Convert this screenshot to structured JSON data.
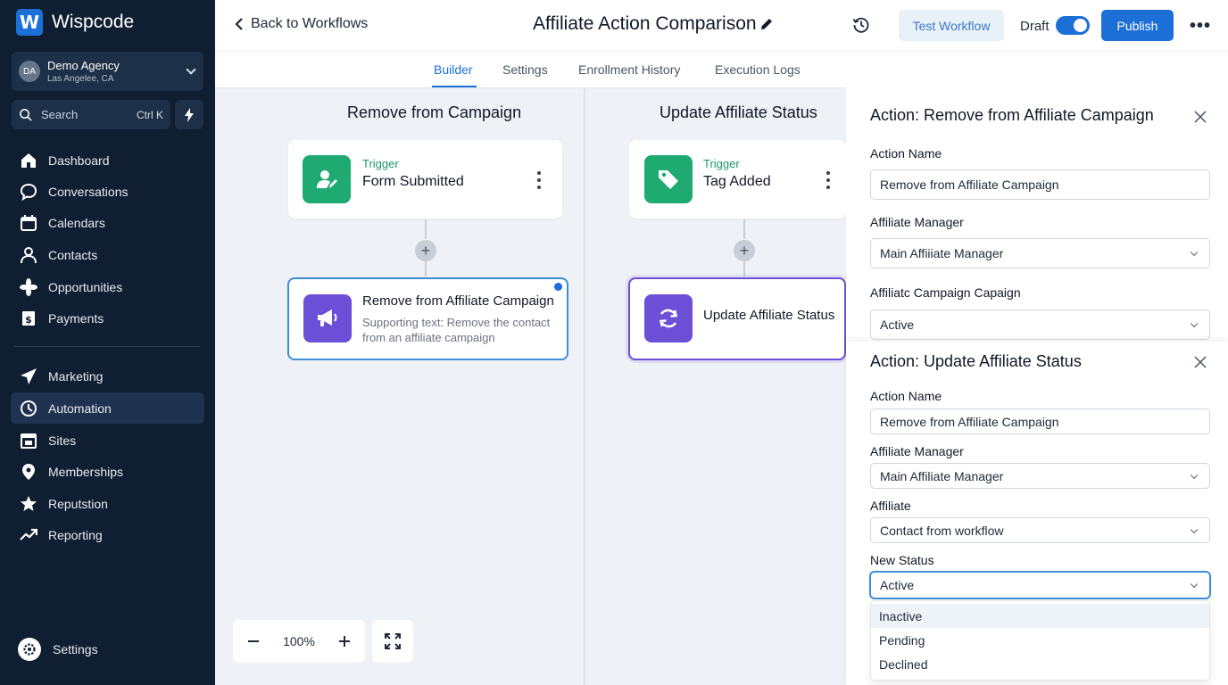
{
  "brand": {
    "logo_letter": "W",
    "name": "Wispcode"
  },
  "account": {
    "initials": "DA",
    "name": "Demo Agency",
    "location": "Las Angelee, CA"
  },
  "search": {
    "label": "Search",
    "shortcut": "Ctrl K"
  },
  "nav": {
    "dashboard": "Dashboard",
    "conversations": "Conversations",
    "calendars": "Calendars",
    "contacts": "Contacts",
    "opportunities": "Opportunities",
    "payments": "Payments",
    "marketing": "Marketing",
    "automation": "Automation",
    "sites": "Sites",
    "memberships": "Memberships",
    "reputation": "Reputstion",
    "reporting": "Reporting",
    "settings": "Settings"
  },
  "topbar": {
    "back_label": "Back to Workflows",
    "title": "Affiliate Action Comparison",
    "test_label": "Test Workflow",
    "draft_label": "Draft",
    "publish_label": "Publish",
    "more_label": "•••"
  },
  "tabs": {
    "builder": "Builder",
    "settings": "Settings",
    "enrollment": "Enrollment History",
    "logs": "Execution Logs"
  },
  "canvas": {
    "left": {
      "title": "Remove from Campaign",
      "trigger_sub": "Trigger",
      "trigger_title": "Form Submitted",
      "action_title": "Remove from Affiliate Campaign",
      "action_support_1": "Supporting text: Remove the contact",
      "action_support_2": "from an affiliate campaign"
    },
    "right": {
      "title": "Update Affiliate Status",
      "trigger_sub": "Trigger",
      "trigger_title": "Tag Added",
      "action_title": "Update Affiliate Status"
    },
    "zoom": "100%",
    "plus": "+"
  },
  "panel1": {
    "title": "Action: Remove from Affiliate Campaign",
    "action_name_label": "Action Name",
    "action_name_value": "Remove from Affiliate Campaign",
    "manager_label": "Affiliate Manager",
    "manager_value": "Main Affiiiate Manager",
    "campaign_label": "Affiliatc Campaign Capaign",
    "campaign_value": "Active"
  },
  "panel2": {
    "title": "Action: Update Affiliate Status",
    "action_name_label": "Action Name",
    "action_name_value": "Remove from Affiliate Campaign",
    "manager_label": "Affiliate Manager",
    "manager_value": "Main Affiliate Manager",
    "affiliate_label": "Affiliate",
    "affiliate_value": "Contact from workflow",
    "status_label": "New Status",
    "status_value": "Active",
    "status_options": [
      "Inactive",
      "Pending",
      "Declined"
    ]
  },
  "colors": {
    "accent": "#1d6fd8",
    "sidebar_bg": "#0f1e31",
    "trigger_green": "#1faa72",
    "action_purple": "#6b4fd6"
  }
}
